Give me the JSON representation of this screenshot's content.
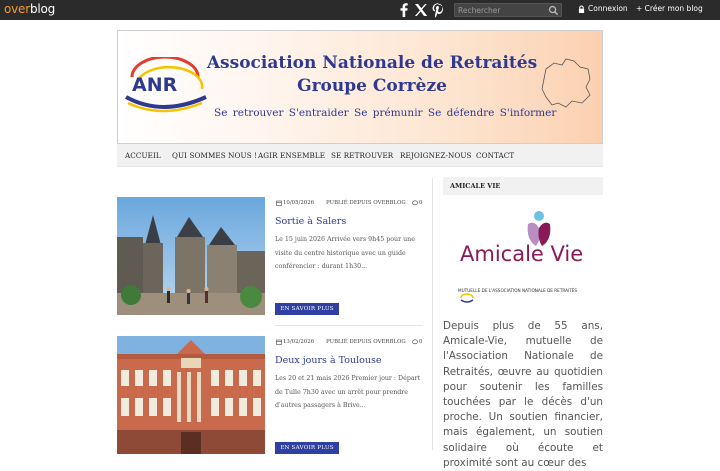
{
  "topbar": {
    "logo_over": "over",
    "logo_blog": "blog",
    "social_icons": [
      "facebook-icon",
      "x-icon",
      "pinterest-icon"
    ],
    "search_placeholder": "Rechercher",
    "login_label": "Connexion",
    "create_label": "+ Créer mon blog"
  },
  "banner": {
    "logo_text": "ANR",
    "title_line1": "Association Nationale de Retraités",
    "title_line2": "Groupe Corrèze",
    "tagline": "Se retrouver S'entraider Se prémunir Se défendre S'informer"
  },
  "nav": {
    "items": [
      "ACCUEIL",
      "QUI SOMMES NOUS !",
      "AGIR ENSEMBLE",
      "SE RETROUVER",
      "REJOIGNEZ-NOUS",
      "CONTACT"
    ]
  },
  "posts": [
    {
      "date": "10/05/2026",
      "source": "PUBLIÉ DEPUIS OVERBLOG",
      "comments": "0",
      "title": "Sortie à Salers",
      "excerpt": "Le 15 juin 2026 Arrivée vers 9h45 pour une visite du centre historique avec un guide conférencier : durant 1h30...",
      "button": "EN SAVOIR PLUS"
    },
    {
      "date": "13/02/2026",
      "source": "PUBLIÉ DEPUIS OVERBLOG",
      "comments": "0",
      "title": "Deux jours à Toulouse",
      "excerpt": "Les 20 et 21 mais 2026 Premier jour : Départ de Tulle 7h30 avec un arrêt pour prendre d'autres passagers à Brive...",
      "button": "EN SAVOIR PLUS"
    }
  ],
  "sidebar": {
    "heading": "AMICALE VIE",
    "logo_text": "Amicale Vie",
    "logo_sub": "MUTUELLE DE L'ASSOCIATION NATIONALE DE RETRAITÉS",
    "text": "Depuis plus de 55 ans, Amicale-Vie, mutuelle de l'Association Nationale de Retraités, œuvre au quotidien pour soutenir les familles touchées par le décès d'un proche. Un soutien financier, mais également, un soutien solidaire où écoute et proximité sont au cœur des"
  },
  "colors": {
    "brand_blue": "#2f3a8f",
    "button_blue": "#2f3fa2",
    "overblog_orange": "#f39a2e",
    "amicale_purple": "#8a1a55"
  }
}
